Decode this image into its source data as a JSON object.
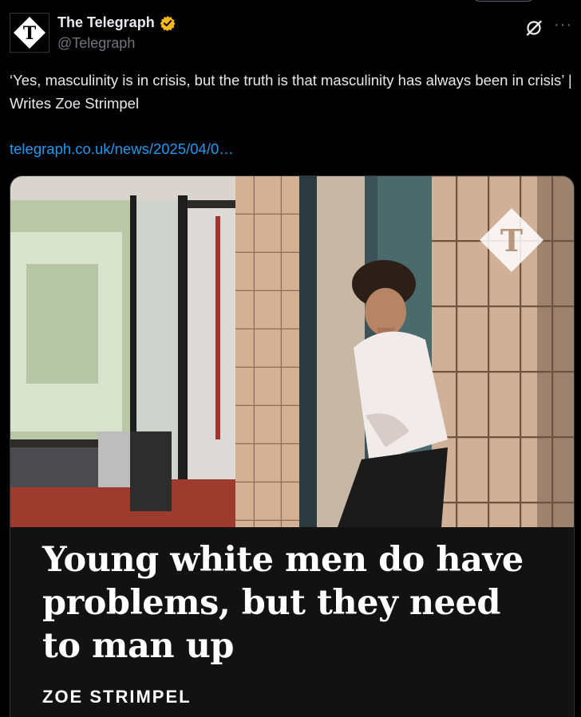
{
  "account": {
    "display_name": "The Telegraph",
    "handle": "@Telegraph",
    "verified": true,
    "avatar_icon": "telegraph-logo-icon",
    "verified_badge_color": "#f4b81e"
  },
  "tweet": {
    "text": "‘Yes, masculinity is in crisis, but the truth is that masculinity has always been in crisis’ | Writes Zoe Strimpel",
    "link": "telegraph.co.uk/news/2025/04/0…",
    "link_color": "#1d9bf0"
  },
  "actions": {
    "grok_icon": "grok-icon",
    "more_label": "···"
  },
  "card": {
    "image_icon": "telegraph-watermark-icon",
    "headline": "Young white men do have problems, but they need to man up",
    "byline": "ZOE STRIMPEL"
  }
}
